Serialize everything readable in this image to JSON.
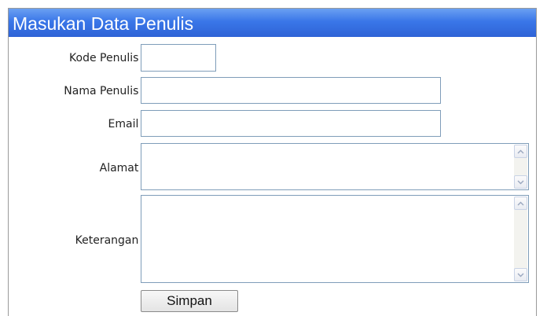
{
  "form": {
    "title": "Masukan Data Penulis",
    "fields": {
      "kode": {
        "label": "Kode Penulis",
        "value": ""
      },
      "nama": {
        "label": "Nama Penulis",
        "value": ""
      },
      "email": {
        "label": "Email",
        "value": ""
      },
      "alamat": {
        "label": "Alamat",
        "value": ""
      },
      "keterangan": {
        "label": "Keterangan",
        "value": ""
      }
    },
    "colon": ":",
    "submit_label": "Simpan"
  },
  "icons": {
    "scroll_up": "chevron-up-icon",
    "scroll_down": "chevron-down-icon"
  },
  "colors": {
    "title_bar": "#3a76e8",
    "title_text": "#ffffff",
    "input_border": "#7f9db9"
  }
}
